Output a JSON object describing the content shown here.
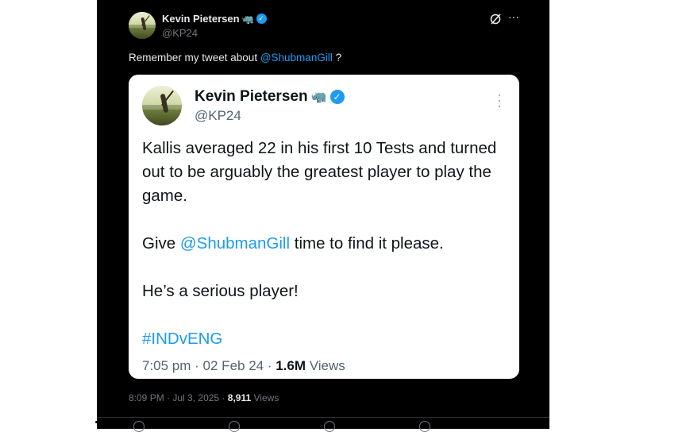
{
  "outer_tweet": {
    "author_name": "Kevin Pietersen",
    "author_emoji": "🦏",
    "handle": "@KP24",
    "text_before": "Remember my tweet about ",
    "mention": "@ShubmanGill",
    "text_after": " ?",
    "time": "8:09 PM",
    "date": "Jul 3, 2025",
    "views_count": "8,911",
    "views_label": "Views",
    "icons": [
      "grok-icon",
      "more-icon"
    ]
  },
  "quoted_tweet": {
    "author_name": "Kevin Pietersen",
    "author_emoji": "🦏",
    "handle": "@KP24",
    "paragraph1": "Kallis averaged 22 in his first 10 Tests and turned out to be arguably the greatest player to play the game.",
    "p2_before": "Give ",
    "p2_mention": "@ShubmanGill",
    "p2_after": " time to find it please.",
    "paragraph3": "He’s a serious player!",
    "hashtag": "#INDvENG",
    "time": "7:05 pm",
    "date": "02 Feb 24",
    "views_count": "1.6M",
    "views_label": "Views"
  },
  "colors": {
    "background": "#000000",
    "card": "#ffffff",
    "accent": "#1d9bf0",
    "muted": "#71767b"
  }
}
